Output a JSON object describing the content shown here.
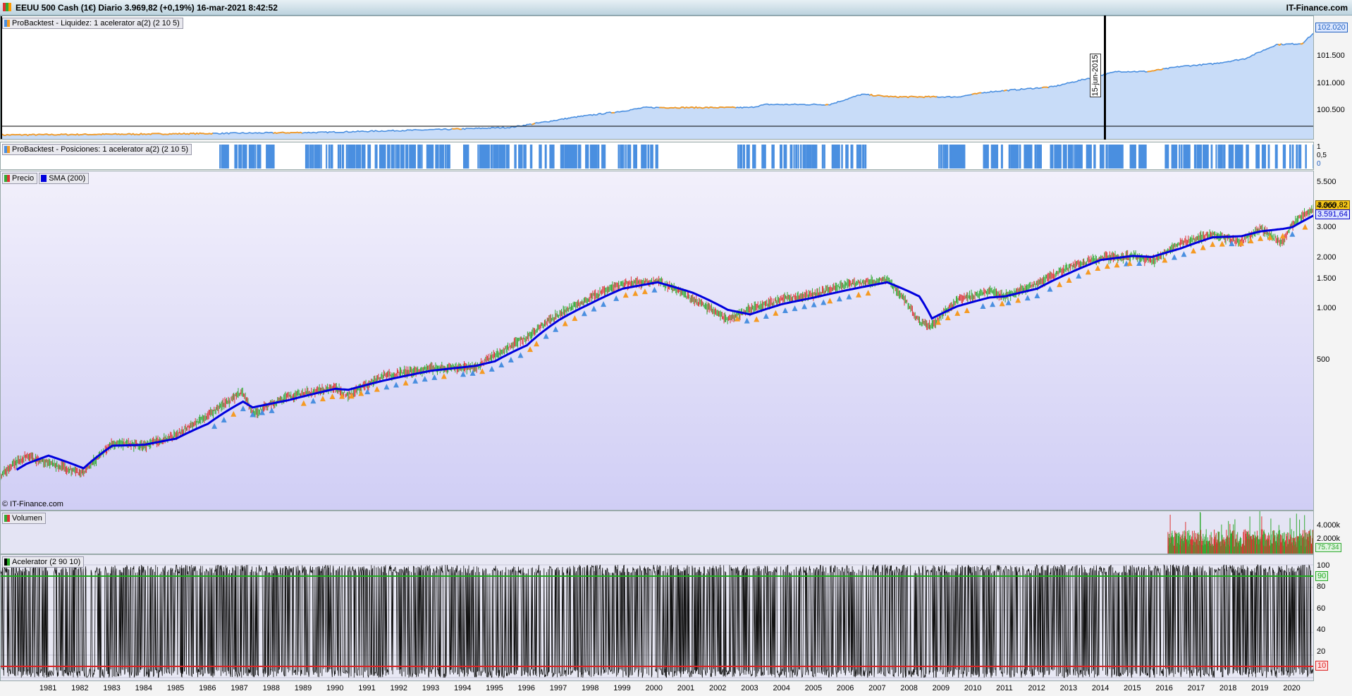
{
  "window": {
    "title": "EEUU 500 Cash (1€) Diario 3.969,82 (+0,19%) 16-mar-2021 8:42:52",
    "brand": "IT-Finance.com"
  },
  "colors": {
    "equity_fill": "#c8dcf8",
    "equity_line": "#4a8fe0",
    "equity_flat": "#f59a23",
    "position_bar": "#4a8fe0",
    "sma": "#0000dd",
    "price_up": "#33aa33",
    "price_down": "#dd3333",
    "accel_green": "#22aa22",
    "accel_red": "#dd2222"
  },
  "panels": {
    "equity": {
      "legend": "ProBacktest - Liquidez: 1  acelerator a(2) (2 10 5)",
      "y_ticks": [
        "101.500",
        "101.000",
        "100.500"
      ],
      "last_value": "102.020",
      "marker_date": "15-jun-2015"
    },
    "positions": {
      "legend": "ProBacktest - Posiciones: 1  acelerator a(2) (2 10 5)",
      "y_ticks": [
        "1",
        "0,5",
        "0"
      ]
    },
    "price": {
      "legend_price": "Precio",
      "legend_sma": "SMA (200)",
      "y_ticks": [
        "5.500",
        "4.000",
        "3.000",
        "2.000",
        "1.500",
        "1.000",
        "500"
      ],
      "last_price": "3.969,82",
      "last_sma": "3.591,64",
      "watermark": "IT-Finance.com"
    },
    "volume": {
      "legend": "Volumen",
      "y_ticks": [
        "4.000k",
        "2.000k"
      ],
      "last_value": "75.734"
    },
    "accelerator": {
      "legend": "Acelerator (2 90 10)",
      "y_ticks": [
        "100",
        "80",
        "60",
        "40",
        "20"
      ],
      "upper_level": "90",
      "lower_level": "10"
    }
  },
  "x_axis": [
    "1981",
    "1982",
    "1983",
    "1984",
    "1985",
    "1986",
    "1987",
    "1988",
    "1989",
    "1990",
    "1991",
    "1992",
    "1993",
    "1994",
    "1995",
    "1996",
    "1997",
    "1998",
    "1999",
    "2000",
    "2001",
    "2002",
    "2003",
    "2004",
    "2005",
    "2006",
    "2007",
    "2008",
    "2009",
    "2010",
    "2011",
    "2012",
    "2013",
    "2014",
    "2015",
    "2016",
    "2017",
    "2018",
    "2019",
    "2020"
  ],
  "chart_data": [
    {
      "type": "area",
      "title": "ProBacktest - Liquidez",
      "x": [
        1980.0,
        1985,
        1990,
        1994,
        1996,
        1998,
        1999.5,
        2000.2,
        2003.5,
        2004,
        2006,
        2007,
        2008,
        2010,
        2011,
        2012,
        2013,
        2015,
        2016,
        2017,
        2018,
        2019,
        2020,
        2020.8,
        2021.2
      ],
      "values": [
        100000,
        100020,
        100050,
        100110,
        100150,
        100350,
        100470,
        100540,
        100540,
        100600,
        100600,
        100800,
        100750,
        100750,
        100850,
        100900,
        100950,
        101250,
        101250,
        101350,
        101400,
        101500,
        101780,
        101800,
        102020
      ],
      "ylim": [
        99950,
        102200
      ]
    },
    {
      "type": "bar",
      "title": "ProBacktest - Posiciones",
      "in_position_periods": [
        [
          1986.7,
          1988.5
        ],
        [
          1989.5,
          1991.4
        ],
        [
          1991.5,
          1994.1
        ],
        [
          1994.5,
          1996.6
        ],
        [
          1996.8,
          1999.1
        ],
        [
          1999.3,
          2000.6
        ],
        [
          2003.1,
          2005.8
        ],
        [
          2006.0,
          2007.2
        ],
        [
          2009.4,
          2010.4
        ],
        [
          2010.8,
          2011.4
        ],
        [
          2011.6,
          2012.6
        ],
        [
          2012.9,
          2015.3
        ],
        [
          2015.4,
          2015.9
        ],
        [
          2016.5,
          2019.1
        ],
        [
          2019.2,
          2020.0
        ],
        [
          2020.2,
          2020.7
        ],
        [
          2020.9,
          2021.2
        ]
      ],
      "ylim": [
        0,
        1
      ]
    },
    {
      "type": "line",
      "title": "Precio / SMA (200)",
      "y_scale": "log",
      "x": [
        1980.0,
        1980.8,
        1981.5,
        1982.6,
        1983.5,
        1984.5,
        1985.5,
        1986.5,
        1987.6,
        1987.9,
        1989.0,
        1990.5,
        1990.9,
        1992.0,
        1993.5,
        1994.9,
        1995.5,
        1996.5,
        1997.5,
        1998.5,
        1999.5,
        2000.6,
        2001.7,
        2002.8,
        2003.5,
        2004.5,
        2005.5,
        2006.5,
        2007.8,
        2008.8,
        2009.2,
        2010.0,
        2011.0,
        2011.5,
        2012.5,
        2013.5,
        2014.5,
        2015.5,
        2016.1,
        2017.0,
        2018.0,
        2018.9,
        2019.5,
        2020.2,
        2020.5,
        2021.2
      ],
      "series": [
        {
          "name": "Precio",
          "values": [
            108,
            140,
            126,
            110,
            165,
            160,
            185,
            240,
            330,
            245,
            310,
            350,
            315,
            410,
            455,
            460,
            540,
            690,
            940,
            1180,
            1420,
            1480,
            1150,
            880,
            1010,
            1150,
            1230,
            1410,
            1500,
            850,
            800,
            1140,
            1280,
            1200,
            1420,
            1780,
            2020,
            2080,
            1920,
            2450,
            2780,
            2500,
            2980,
            2450,
            3200,
            3970
          ]
        },
        {
          "name": "SMA (200)",
          "values": [
            100,
            125,
            140,
            118,
            160,
            162,
            176,
            215,
            290,
            268,
            295,
            345,
            340,
            385,
            440,
            470,
            500,
            620,
            870,
            1090,
            1330,
            1450,
            1260,
            1000,
            940,
            1080,
            1180,
            1300,
            1450,
            1200,
            890,
            1050,
            1180,
            1200,
            1330,
            1640,
            1960,
            2070,
            2040,
            2290,
            2660,
            2700,
            2880,
            2980,
            3050,
            3592
          ]
        }
      ],
      "last_price": 3969.82,
      "last_sma": 3591.64
    },
    {
      "type": "bar",
      "title": "Volumen",
      "x_range": [
        2016.6,
        2021.2
      ],
      "typical_value_k": [
        1000,
        3000
      ],
      "last_value": 75734
    },
    {
      "type": "line",
      "title": "Acelerator (2 90 10)",
      "ylim": [
        0,
        100
      ],
      "levels": {
        "upper": 90,
        "lower": 10
      },
      "behavior": "oscillates rapidly between 0 and 100 across the full period"
    }
  ]
}
